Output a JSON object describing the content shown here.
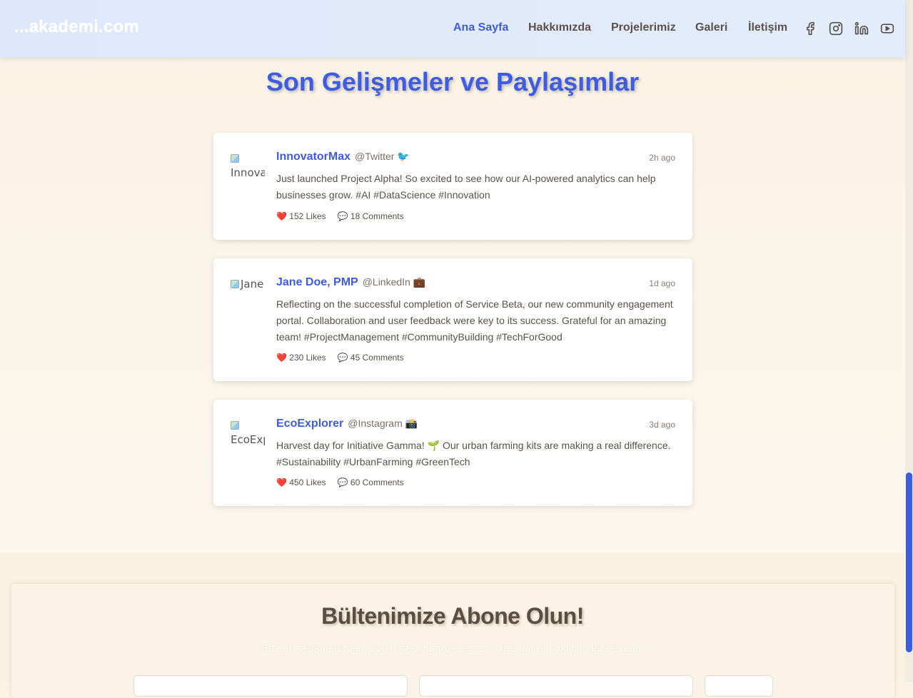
{
  "navbar": {
    "brand": "...akademi.com",
    "links": [
      "Ana Sayfa",
      "Hakkımızda",
      "Projelerimiz",
      "Galeri",
      "İletişim"
    ],
    "active_link": "Ana Sayfa",
    "socials": [
      "facebook-icon",
      "instagram-icon",
      "linkedin-icon",
      "youtube-icon"
    ],
    "accent_color": "#3d5ce0"
  },
  "feed": {
    "title": "Son Gelişmeler ve Paylaşımlar",
    "posts": [
      {
        "avatar_alt": "Innovat",
        "author": "InnovatorMax",
        "platform": "@Twitter 🐦",
        "time": "2h ago",
        "text": "Just launched Project Alpha! So excited to see how our AI-powered analytics can help businesses grow. #AI #DataScience #Innovation",
        "likes": "❤️ 152 Likes",
        "comments": "💬 18 Comments"
      },
      {
        "avatar_alt": "Jane",
        "author": "Jane Doe, PMP",
        "platform": "@LinkedIn 💼",
        "time": "1d ago",
        "text": "Reflecting on the successful completion of Service Beta, our new community engagement portal. Collaboration and user feedback were key to its success. Grateful for an amazing team! #ProjectManagement #CommunityBuilding #TechForGood",
        "likes": "❤️ 230 Likes",
        "comments": "💬 45 Comments"
      },
      {
        "avatar_alt": "EcoExp",
        "author": "EcoExplorer",
        "platform": "@Instagram 📸",
        "time": "3d ago",
        "text": "Harvest day for Initiative Gamma! 🌱 Our urban farming kits are making a real difference. #Sustainability #UrbanFarming #GreenTech",
        "likes": "❤️ 450 Likes",
        "comments": "💬 60 Comments"
      }
    ]
  },
  "newsletter": {
    "title": "Bültenimize Abone Olun!",
    "subtitle": "En son gelişmelerden, etkinlikten ve projelerden haberdar olmak için abone olun."
  }
}
